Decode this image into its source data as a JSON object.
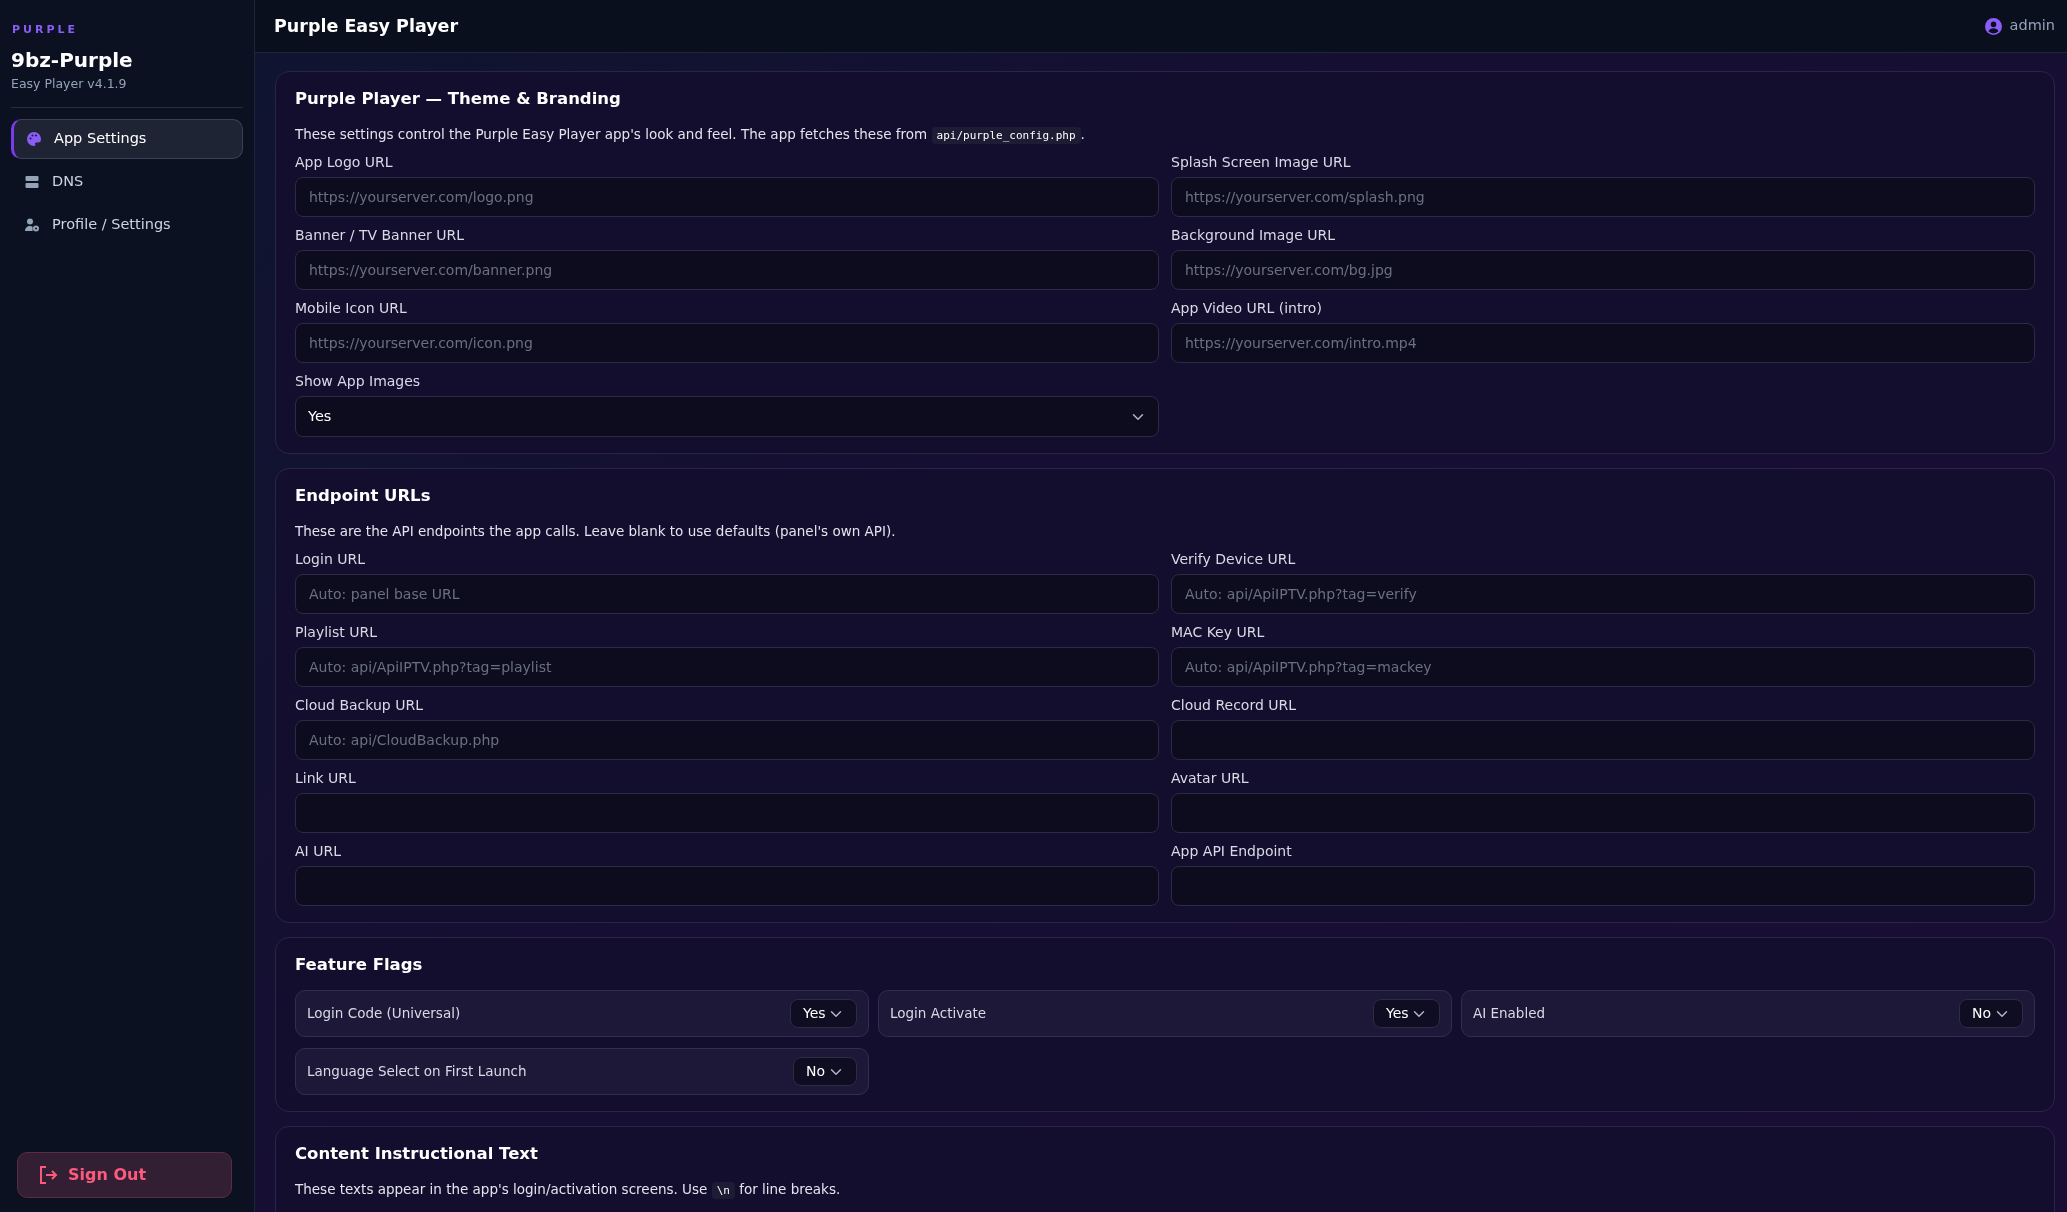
{
  "sidebar": {
    "brand_tag": "PURPLE",
    "brand": "9bz-Purple",
    "version": "Easy Player v4.1.9",
    "items": [
      {
        "label": "App Settings",
        "selected": true
      },
      {
        "label": "DNS",
        "selected": false
      },
      {
        "label": "Profile / Settings",
        "selected": false
      }
    ],
    "sign_out": "Sign Out"
  },
  "header": {
    "title": "Purple Easy Player",
    "user": "admin"
  },
  "sections": [
    {
      "kind": "fields",
      "title": "Purple Player — Theme & Branding",
      "description": {
        "before": "These settings control the Purple Easy Player app's look and feel. The app fetches these from ",
        "code": "api/purple_config.php",
        "after": "."
      },
      "fields": [
        {
          "kind": "input",
          "label": "App Logo URL",
          "placeholder": "https://yourserver.com/logo.png"
        },
        {
          "kind": "input",
          "label": "Splash Screen Image URL",
          "placeholder": "https://yourserver.com/splash.png"
        },
        {
          "kind": "input",
          "label": "Banner / TV Banner URL",
          "placeholder": "https://yourserver.com/banner.png"
        },
        {
          "kind": "input",
          "label": "Background Image URL",
          "placeholder": "https://yourserver.com/bg.jpg"
        },
        {
          "kind": "input",
          "label": "Mobile Icon URL",
          "placeholder": "https://yourserver.com/icon.png"
        },
        {
          "kind": "input",
          "label": "App Video URL (intro)",
          "placeholder": "https://yourserver.com/intro.mp4"
        },
        {
          "kind": "select",
          "label": "Show App Images",
          "value": "Yes"
        }
      ]
    },
    {
      "kind": "fields",
      "title": "Endpoint URLs",
      "description": {
        "before": "These are the API endpoints the app calls. Leave blank to use defaults (panel's own API)."
      },
      "fields": [
        {
          "kind": "input",
          "label": "Login URL",
          "placeholder": "Auto: panel base URL"
        },
        {
          "kind": "input",
          "label": "Verify Device URL",
          "placeholder": "Auto: api/ApiIPTV.php?tag=verify"
        },
        {
          "kind": "input",
          "label": "Playlist URL",
          "placeholder": "Auto: api/ApiIPTV.php?tag=playlist"
        },
        {
          "kind": "input",
          "label": "MAC Key URL",
          "placeholder": "Auto: api/ApiIPTV.php?tag=mackey"
        },
        {
          "kind": "input",
          "label": "Cloud Backup URL",
          "placeholder": "Auto: api/CloudBackup.php"
        },
        {
          "kind": "input",
          "label": "Cloud Record URL"
        },
        {
          "kind": "input",
          "label": "Link URL"
        },
        {
          "kind": "input",
          "label": "Avatar URL"
        },
        {
          "kind": "input",
          "label": "AI URL"
        },
        {
          "kind": "input",
          "label": "App API Endpoint"
        }
      ]
    },
    {
      "kind": "flags",
      "title": "Feature Flags",
      "flags": [
        {
          "label": "Login Code (Universal)",
          "value": "Yes"
        },
        {
          "label": "Login Activate",
          "value": "Yes"
        },
        {
          "label": "AI Enabled",
          "value": "No"
        },
        {
          "label": "Language Select on First Launch",
          "value": "No"
        }
      ]
    },
    {
      "kind": "fields",
      "title": "Content Instructional Text",
      "description": {
        "before": "These texts appear in the app's login/activation screens. Use ",
        "code": "\\n",
        "after": " for line breaks."
      }
    }
  ]
}
